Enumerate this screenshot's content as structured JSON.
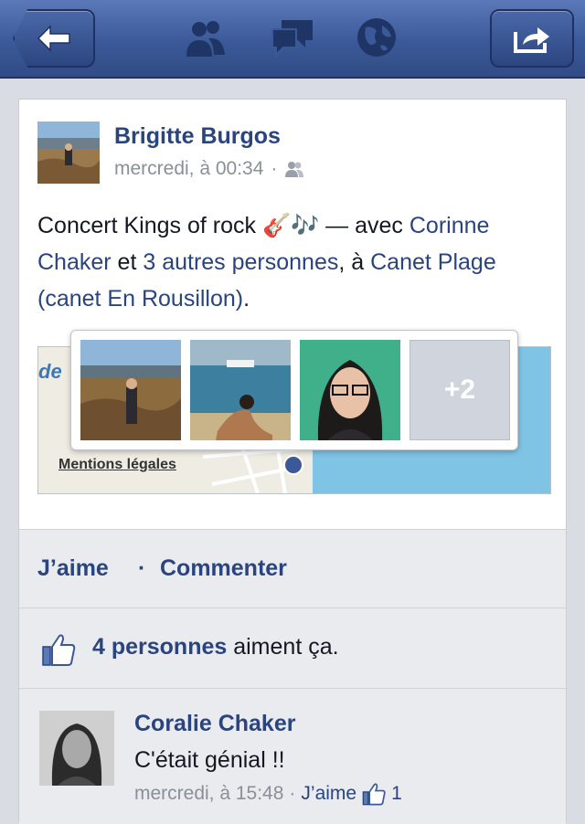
{
  "nav": {
    "back_icon": "arrow-left-icon",
    "friends_icon": "friends-icon",
    "messages_icon": "messages-icon",
    "globe_icon": "globe-icon",
    "share_icon": "share-icon"
  },
  "post": {
    "author": "Brigitte Burgos",
    "time": "mercredi, à 00:34",
    "meta_separator": "·",
    "text_start": "Concert Kings of rock",
    "emoji": "🎸🎶",
    "text_with": " — avec ",
    "tag_person": "Corinne Chaker",
    "text_and": " et ",
    "tag_others": "3 autres personnes",
    "text_at": ", à ",
    "place": "Canet Plage (canet En Rousillon)",
    "text_end": ".",
    "map_label": "de",
    "map_legal": "Mentions légales",
    "more_photos": "+2"
  },
  "actions": {
    "like": "J’aime",
    "separator": "·",
    "comment": "Commenter"
  },
  "likes": {
    "count_label": "4 personnes",
    "suffix": " aiment ça."
  },
  "comment": {
    "author": "Coralie Chaker",
    "text": "C'était génial !!",
    "time": "mercredi, à 15:48",
    "separator": "·",
    "like_label": "J’aime",
    "like_count": "1"
  },
  "colors": {
    "brand": "#3b5998",
    "link": "#29447e"
  }
}
